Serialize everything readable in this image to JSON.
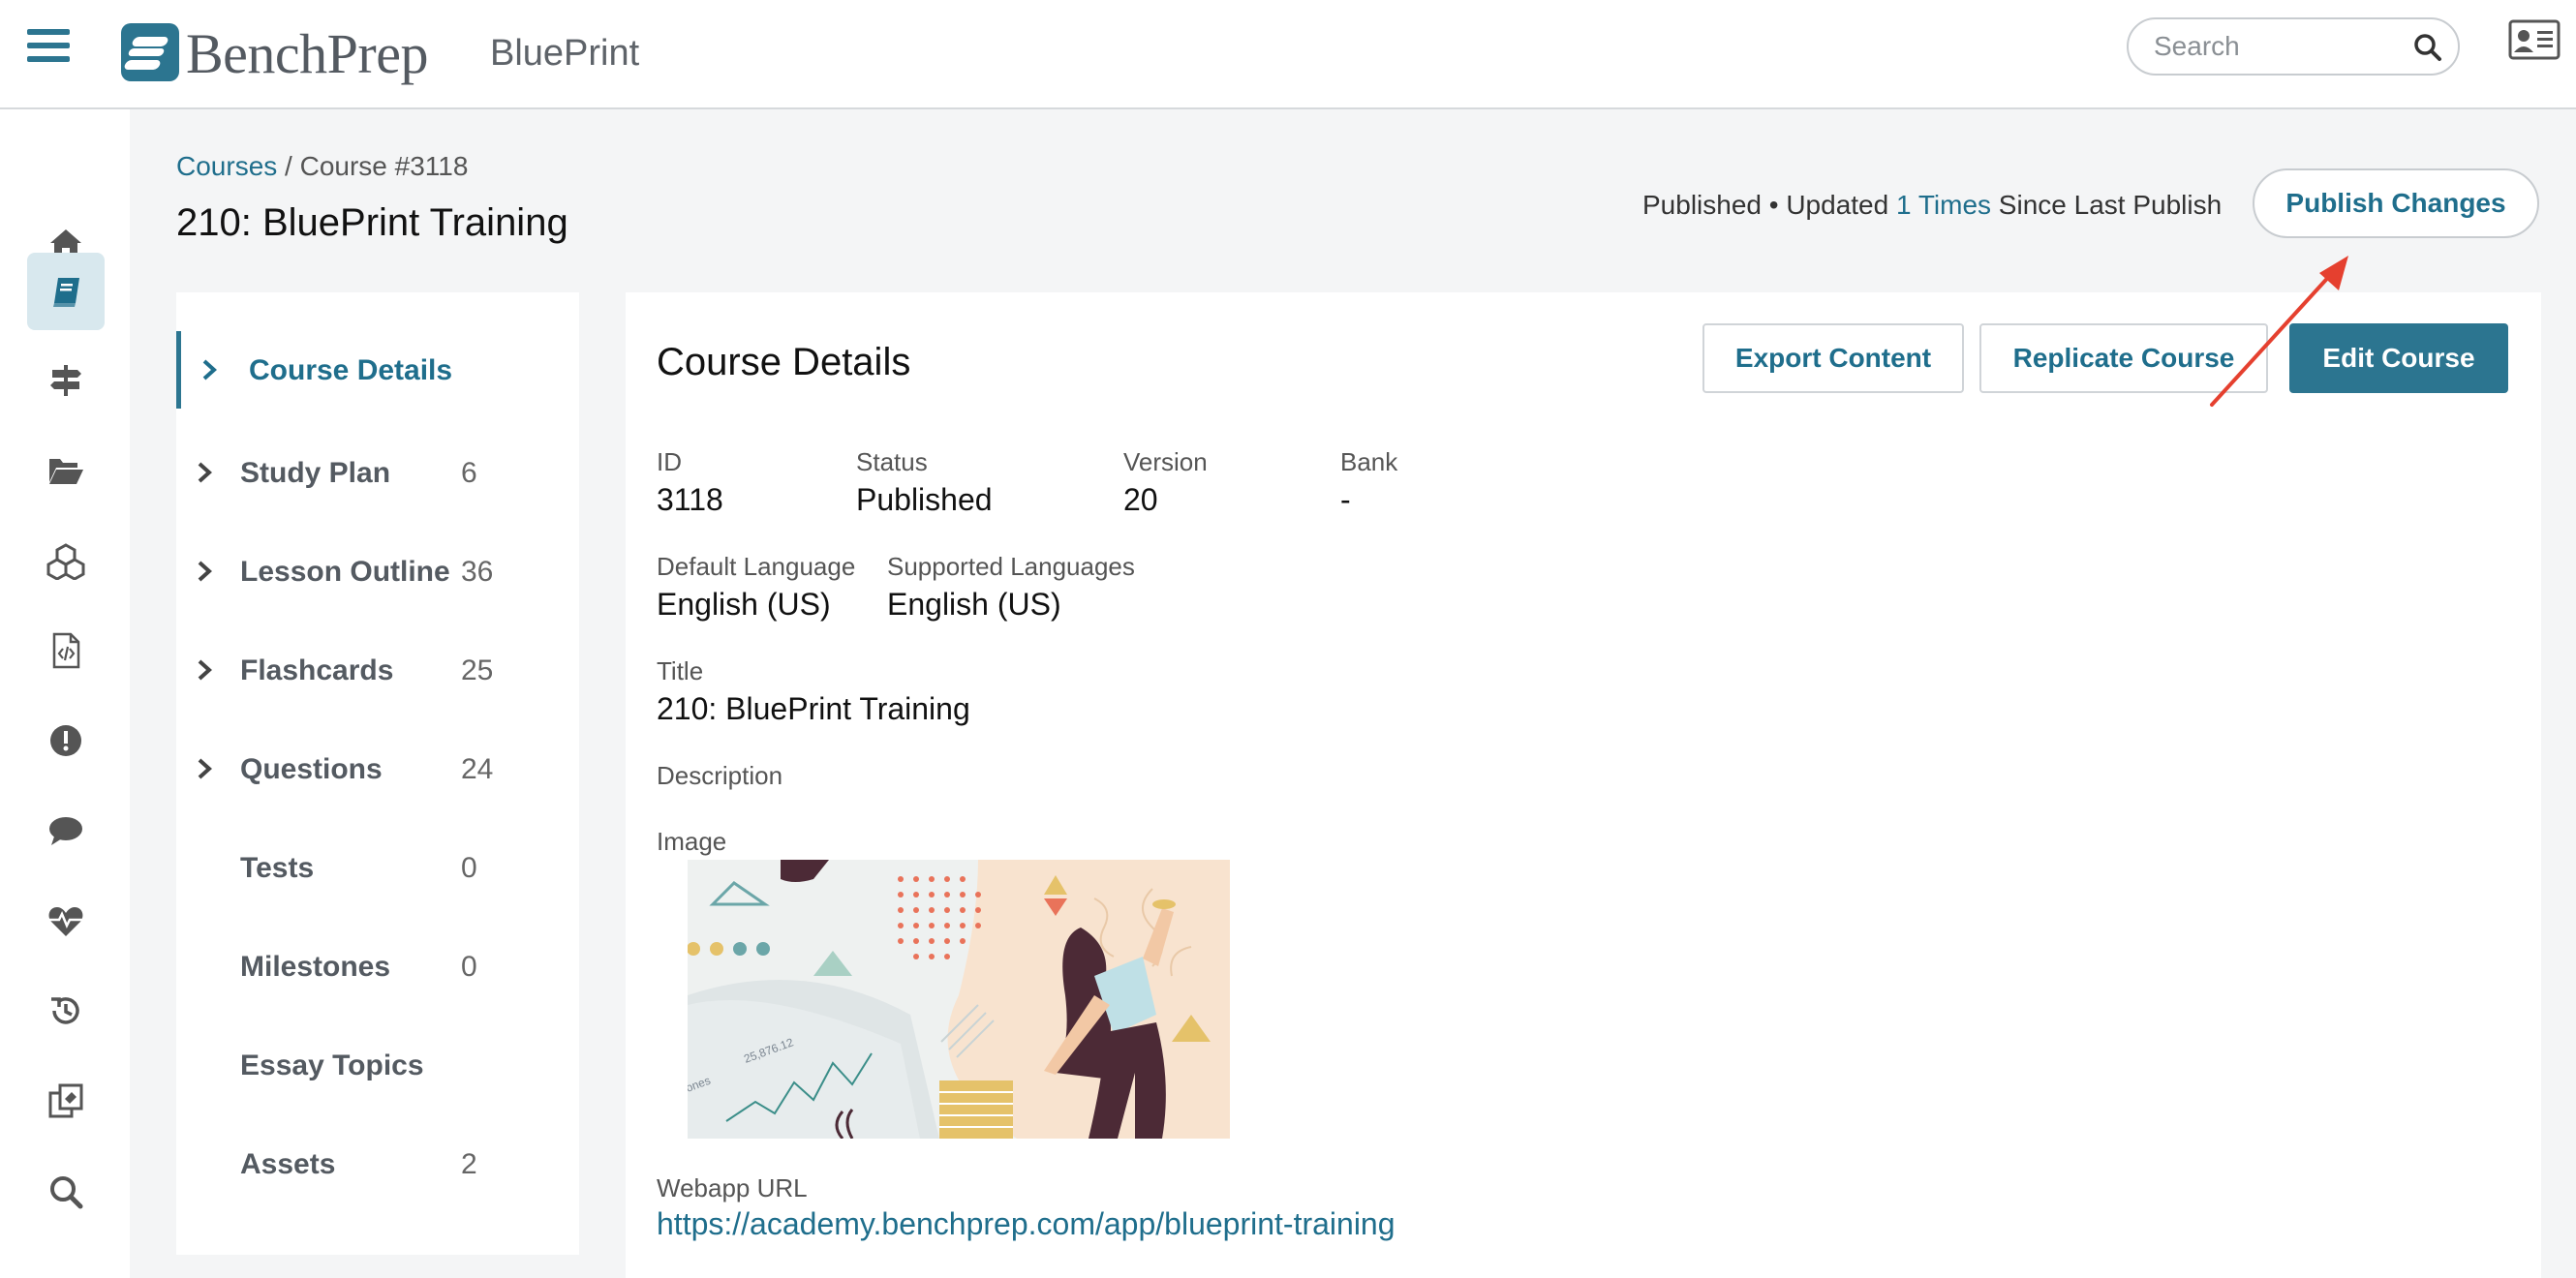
{
  "header": {
    "brand": "BenchPrep",
    "product": "BluePrint",
    "search_placeholder": "Search"
  },
  "rail": {
    "items": [
      "home-icon",
      "book-icon",
      "signpost-icon",
      "folder-open-icon",
      "cubes-icon",
      "file-code-icon",
      "exclamation-circle-icon",
      "comment-icon",
      "heartbeat-icon",
      "history-icon",
      "clone-icon",
      "search-icon"
    ],
    "active": "book-icon"
  },
  "breadcrumb": {
    "root": "Courses",
    "current": "/ Course #3118"
  },
  "page": {
    "title": "210: BluePrint Training",
    "status_prefix": "Published • Updated ",
    "status_times": "1 Times",
    "status_suffix": " Since Last Publish",
    "publish_label": "Publish Changes"
  },
  "sidenav": {
    "items": [
      {
        "label": "Course Details",
        "count": "",
        "chevron": true,
        "active": true
      },
      {
        "label": "Study Plan",
        "count": "6",
        "chevron": true
      },
      {
        "label": "Lesson Outline",
        "count": "36",
        "chevron": true
      },
      {
        "label": "Flashcards",
        "count": "25",
        "chevron": true
      },
      {
        "label": "Questions",
        "count": "24",
        "chevron": true
      },
      {
        "label": "Tests",
        "count": "0",
        "chevron": false
      },
      {
        "label": "Milestones",
        "count": "0",
        "chevron": false
      },
      {
        "label": "Essay Topics",
        "count": "",
        "chevron": false
      },
      {
        "label": "Assets",
        "count": "2",
        "chevron": false
      }
    ]
  },
  "details": {
    "title": "Course Details",
    "export_label": "Export Content",
    "replicate_label": "Replicate Course",
    "edit_label": "Edit Course",
    "id_label": "ID",
    "id_value": "3118",
    "status_label": "Status",
    "status_value": "Published",
    "version_label": "Version",
    "version_value": "20",
    "bank_label": "Bank",
    "bank_value": "-",
    "default_lang_label": "Default Language",
    "default_lang_value": "English (US)",
    "supported_lang_label": "Supported Languages",
    "supported_lang_value": "English (US)",
    "title_label": "Title",
    "title_value": "210: BluePrint Training",
    "description_label": "Description",
    "image_label": "Image",
    "webapp_label": "Webapp URL",
    "webapp_url": "https://academy.benchprep.com/app/blueprint-training"
  },
  "colors": {
    "accent": "#2c7590",
    "link": "#1f6e8c",
    "annotation_arrow": "#e5402f"
  }
}
